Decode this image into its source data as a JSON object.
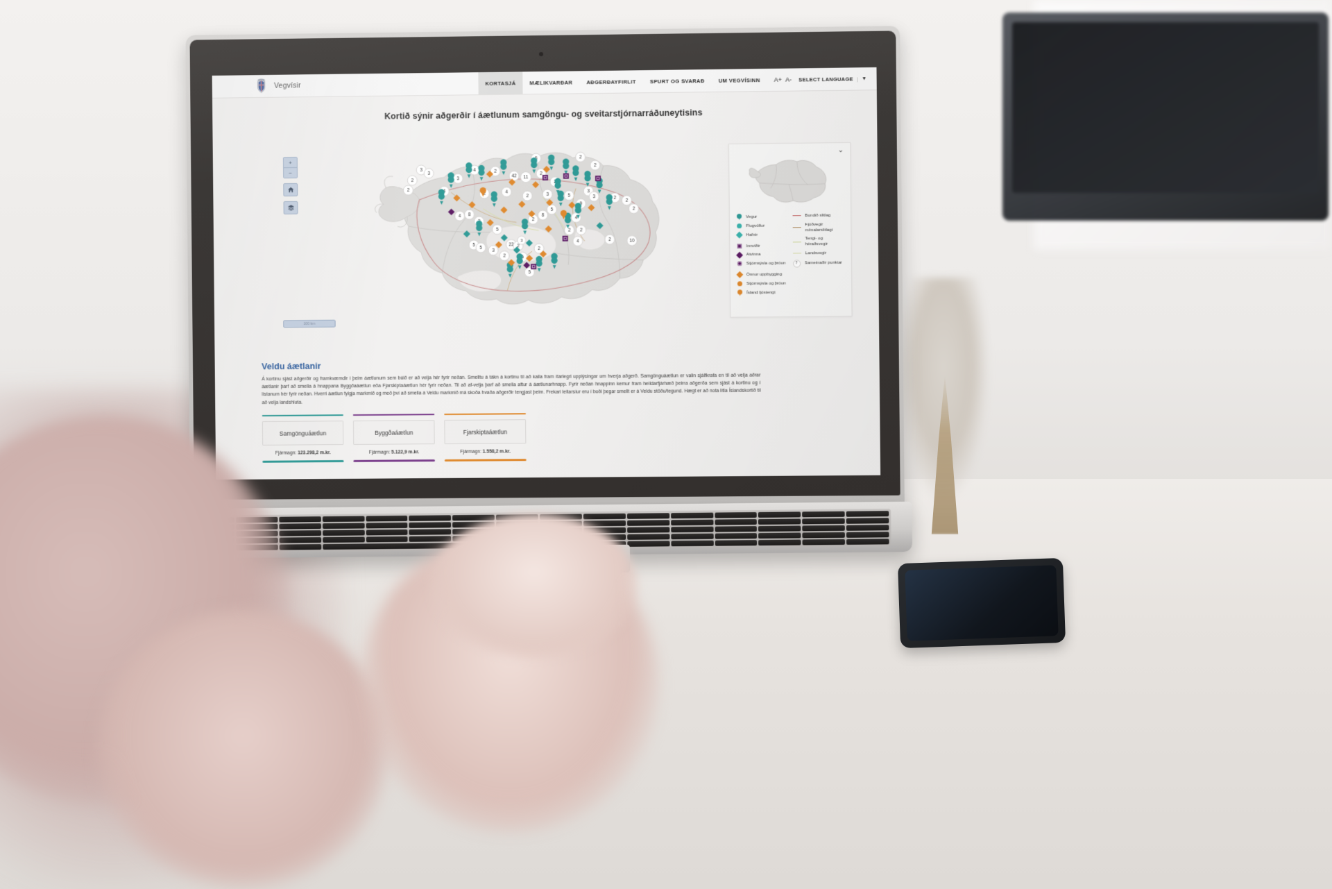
{
  "site": {
    "brand_name": "Vegvísir",
    "crest_icon": "coat-of-arms-icon"
  },
  "nav": {
    "items": [
      {
        "label": "KORTASJÁ",
        "active": true
      },
      {
        "label": "MÆLIKVARÐAR",
        "active": false
      },
      {
        "label": "AÐGERÐAYFIRLIT",
        "active": false
      },
      {
        "label": "SPURT OG SVARAÐ",
        "active": false
      },
      {
        "label": "UM VEGVÍSINN",
        "active": false
      }
    ],
    "font_increase": "A+",
    "font_decrease": "A-",
    "language_label": "SELECT LANGUAGE",
    "language_separator": "|",
    "language_caret": "▼"
  },
  "page": {
    "title": "Kortið sýnir aðgerðir í áætlunum samgöngu- og sveitarstjórnarráðuneytisins"
  },
  "map_controls": {
    "zoom_in": "+",
    "zoom_out": "−",
    "home_icon": "home-icon",
    "layers_icon": "layers-icon",
    "scale_label": "100 km"
  },
  "legend": {
    "collapse_caret": "⌄",
    "minimap_icon": "iceland-minimap",
    "symbols": [
      {
        "name": "Vegur",
        "shape": "pin",
        "color": "#2e9a96"
      },
      {
        "name": "Flugvöllur",
        "shape": "circle",
        "color": "#3bb3ad"
      },
      {
        "name": "Hafnir",
        "shape": "diamond",
        "color": "#3bb3ad"
      },
      {
        "name": "Innviðir",
        "shape": "square",
        "color": "#5b1a63"
      },
      {
        "name": "Atvinna",
        "shape": "diamond",
        "color": "#5b1a63"
      },
      {
        "name": "Stjórnsýsla og þróun",
        "shape": "circle-ring",
        "color": "#5b1a63"
      },
      {
        "name": "Önnur uppbygging",
        "shape": "diamond",
        "color": "#e08a2e"
      },
      {
        "name": "Stjórnsýsla og þróun",
        "shape": "circle",
        "color": "#e08a2e"
      },
      {
        "name": "Ísland ljóstengt",
        "shape": "pin",
        "color": "#e08a2e"
      }
    ],
    "lines": [
      {
        "name": "Bundið slitlag",
        "color": "#c76a6a"
      },
      {
        "name": "Þjóðvegir m/malarslitlagi",
        "color": "#b08b5e"
      },
      {
        "name": "Tengi- og héraðsvegir",
        "color": "#cfd89a"
      },
      {
        "name": "Landsvegir",
        "color": "#d8dca8"
      }
    ],
    "cluster": {
      "badge": "7",
      "name": "Sameinaðir punktar"
    }
  },
  "section": {
    "heading": "Veldu áætlanir",
    "paragraph": "Á kortinu sjást aðgerðir og framkvæmdir í þeim áætlunum sem búið er að velja hér fyrir neðan. Smelltu á tákn á kortinu til að kalla fram ítarlegri upplýsingar um hverja aðgerð. Samgönguáætlun er valin sjálfkrafa en til að velja aðrar áætlanir þarf að smella á hnappana Byggðaáætlun eða Fjarskiptaáætlun hér fyrir neðan. Til að af-velja þarf að smella aftur á áætlunarhnapp. Fyrir neðan hnappinn kemur fram heildarfjárhæð þeirra aðgerða sem sjást á kortinu og í listanum hér fyrir neðan. Hverri áætlun fylgja markmið og með því að smella á Veldu markmið má skoða hvaða aðgerðir tengjast þeim. Frekari leitarsíur eru í boði þegar smellt er á Veldu stöðu/tegund. Hægt er að nota litla Íslandskortið til að velja landshluta."
  },
  "plans": [
    {
      "name": "Samgönguáætlun",
      "amount_label": "Fjármagn:",
      "amount_value": "123.298,2 m.kr.",
      "color": "#2e9a96",
      "selected": true
    },
    {
      "name": "Byggðaáætlun",
      "amount_label": "Fjármagn:",
      "amount_value": "5.122,9 m.kr.",
      "color": "#7b3f8c",
      "selected": false
    },
    {
      "name": "Fjarskiptaáætlun",
      "amount_label": "Fjármagn:",
      "amount_value": "1.558,2 m.kr.",
      "color": "#e08a2e",
      "selected": false
    }
  ],
  "map_markers": {
    "cluster_counts": [
      "6",
      "2",
      "2",
      "3",
      "3",
      "2",
      "3",
      "4",
      "2",
      "42",
      "11",
      "2",
      "2",
      "3",
      "5",
      "2",
      "4",
      "2",
      "5",
      "2",
      "2",
      "3",
      "3",
      "9",
      "2",
      "8",
      "4",
      "2",
      "2",
      "4",
      "2",
      "2",
      "8",
      "4",
      "3",
      "5",
      "5",
      "3",
      "22",
      "2",
      "3",
      "2",
      "2",
      "6",
      "3",
      "2",
      "2",
      "5",
      "10",
      "2",
      "2",
      "6",
      "9",
      "2",
      "2",
      "3",
      "3",
      "4",
      "2"
    ],
    "colors": {
      "teal": "#2e9a96",
      "light_teal": "#3bb3ad",
      "orange": "#e08a2e",
      "purple": "#5b1a63"
    }
  }
}
